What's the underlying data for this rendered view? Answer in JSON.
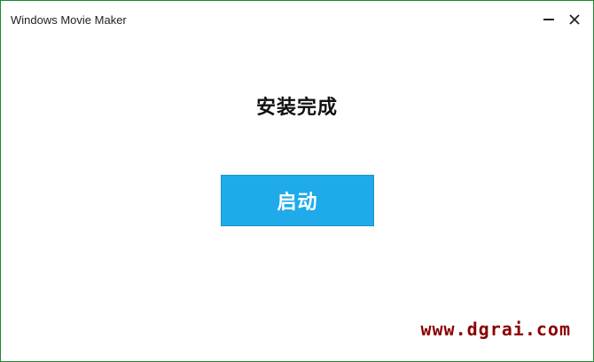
{
  "window": {
    "title": "Windows Movie Maker"
  },
  "controls": {
    "minimize": "minimize",
    "close": "close"
  },
  "main": {
    "heading": "安装完成",
    "launch_label": "启动"
  },
  "watermark": {
    "text": "www.dgrai.com",
    "color": "#8b0000"
  },
  "colors": {
    "accent": "#1fabea",
    "frame": "#1e8a2e"
  }
}
